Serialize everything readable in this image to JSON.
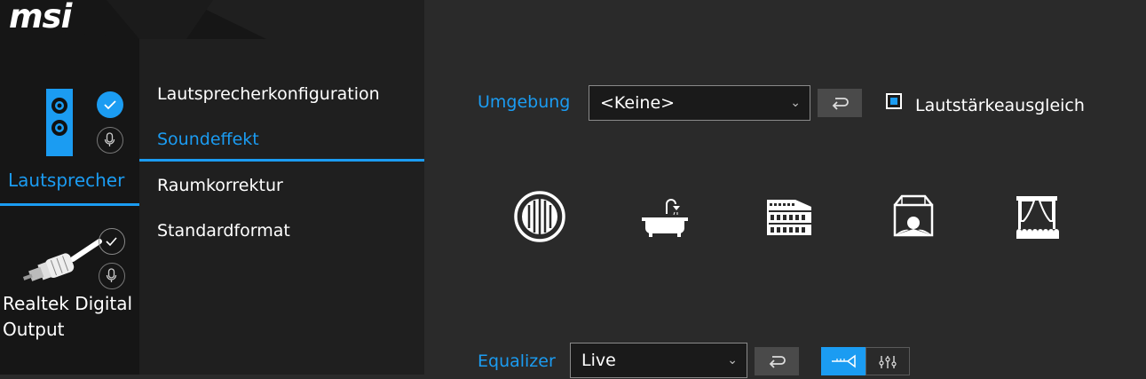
{
  "brand": {
    "logo_text": "msi"
  },
  "devices": [
    {
      "name": "Lautsprecher",
      "active": true,
      "icon": "speaker-icon"
    },
    {
      "name": "Realtek Digital Output",
      "active": false,
      "icon": "rca-connector-icon"
    }
  ],
  "nav": {
    "items": [
      {
        "label": "Lautsprecherkonfiguration",
        "active": false
      },
      {
        "label": "Soundeffekt",
        "active": true
      },
      {
        "label": "Raumkorrektur",
        "active": false
      },
      {
        "label": "Standardformat",
        "active": false
      }
    ]
  },
  "environment": {
    "label": "Umgebung",
    "selected": "<Keine>",
    "loudness_label": "Lautstärkeausgleich",
    "loudness_checked": true,
    "presets": [
      "sewer-pipe-icon",
      "bathroom-icon",
      "colosseum-icon",
      "arena-icon",
      "stage-icon"
    ]
  },
  "equalizer": {
    "label": "Equalizer",
    "selected": "Live"
  },
  "colors": {
    "accent": "#1b9cf2",
    "background": "#2a2a2a",
    "sidebar": "#161616",
    "nav": "#1f1f1f"
  }
}
